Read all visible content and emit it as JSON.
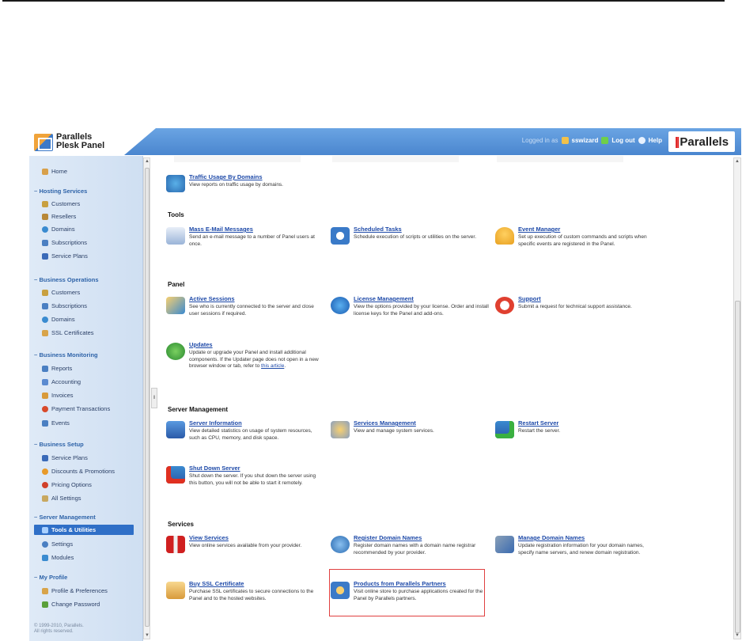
{
  "header": {
    "app_name_line1": "Parallels",
    "app_name_line2": "Plesk Panel",
    "logged_in_label": "Logged in as",
    "username": "sswizard",
    "logout_label": "Log out",
    "help_label": "Help",
    "brand": "Parallels"
  },
  "sidebar": {
    "home": "Home",
    "groups": [
      {
        "title": "Hosting Services",
        "items": [
          "Customers",
          "Resellers",
          "Domains",
          "Subscriptions",
          "Service Plans"
        ]
      },
      {
        "title": "Business Operations",
        "items": [
          "Customers",
          "Subscriptions",
          "Domains",
          "SSL Certificates"
        ]
      },
      {
        "title": "Business Monitoring",
        "items": [
          "Reports",
          "Accounting",
          "Invoices",
          "Payment Transactions",
          "Events"
        ]
      },
      {
        "title": "Business Setup",
        "items": [
          "Service Plans",
          "Discounts & Promotions",
          "Pricing Options",
          "All Settings"
        ]
      },
      {
        "title": "Server Management",
        "items": [
          "Tools & Utilities",
          "Settings",
          "Modules"
        ]
      },
      {
        "title": "My Profile",
        "items": [
          "Profile & Preferences",
          "Change Password"
        ]
      }
    ],
    "copyright_line1": "© 1999-2010, Parallels.",
    "copyright_line2": "All rights reserved."
  },
  "main": {
    "traffic": {
      "title": "Traffic Usage By Domains",
      "desc": "View reports on traffic usage by domains."
    },
    "sections": {
      "tools": "Tools",
      "panel": "Panel",
      "server_management": "Server Management",
      "services": "Services"
    },
    "tools": [
      {
        "title": "Mass E-Mail Messages",
        "desc": "Send an e-mail message to a number of Panel users at once."
      },
      {
        "title": "Scheduled Tasks",
        "desc": "Schedule execution of scripts or utilities on the server."
      },
      {
        "title": "Event Manager",
        "desc": "Set up execution of custom commands and scripts when specific events are registered in the Panel."
      }
    ],
    "panel": [
      {
        "title": "Active Sessions",
        "desc": "See who is currently connected to the server and close user sessions if required."
      },
      {
        "title": "License Management",
        "desc": "View the options provided by your license. Order and install license keys for the Panel and add-ons."
      },
      {
        "title": "Support",
        "desc": "Submit a request for technical support assistance."
      },
      {
        "title": "Updates",
        "desc": "Update or upgrade your Panel and install additional components. If the Updater page does not open in a new browser window or tab, refer to",
        "link": "this article",
        "tail": "."
      }
    ],
    "server_management": [
      {
        "title": "Server Information",
        "desc": "View detailed statistics on usage of system resources, such as CPU, memory, and disk space."
      },
      {
        "title": "Services Management",
        "desc": "View and manage system services."
      },
      {
        "title": "Restart Server",
        "desc": "Restart the server."
      },
      {
        "title": "Shut Down Server",
        "desc": "Shut down the server. If you shut down the server using this button, you will not be able to start it remotely."
      }
    ],
    "services": [
      {
        "title": "View Services",
        "desc": "View online services available from your provider."
      },
      {
        "title": "Register Domain Names",
        "desc": "Register domain names with a domain name registrar recommended by your provider."
      },
      {
        "title": "Manage Domain Names",
        "desc": "Update registration information for your domain names, specify name servers, and renew domain registration."
      },
      {
        "title": "Buy SSL Certificate",
        "desc": "Purchase SSL certificates to secure connections to the Panel and to the hosted websites."
      },
      {
        "title": "Products from Parallels Partners",
        "desc": "Visit online store to purchase applications created for the Panel by Parallels partners."
      }
    ]
  },
  "colors": {
    "header_blue": "#4a86cf",
    "link_blue": "#1d49a8",
    "highlight_red": "#e04040",
    "active_nav": "#2f6fc7"
  }
}
